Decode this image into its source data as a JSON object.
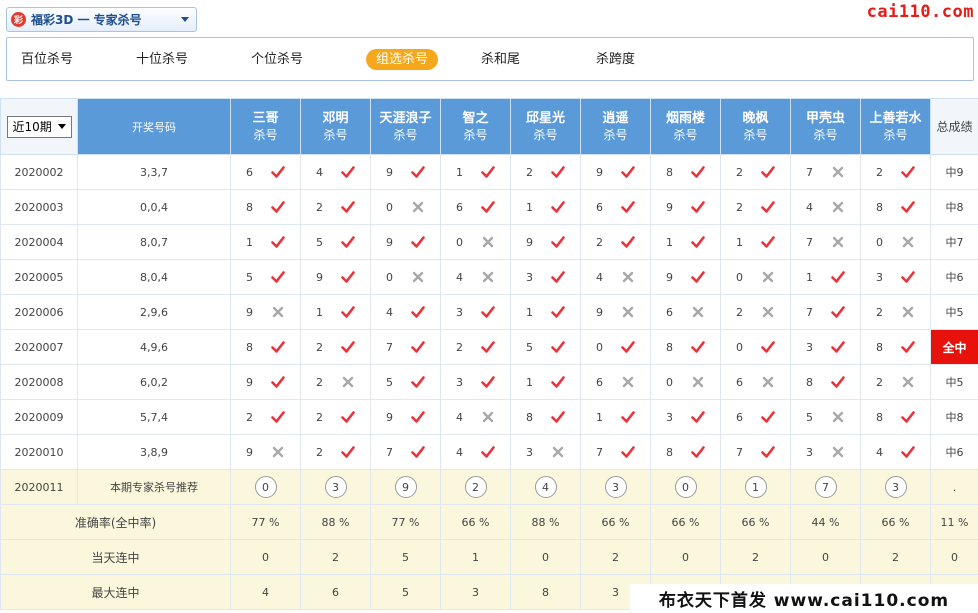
{
  "header": {
    "lottery_label": "福彩3D 一 专家杀号",
    "logo_glyph": "彩",
    "site_brand": "cai110.com"
  },
  "tabs": [
    {
      "label": "百位杀号",
      "active": false
    },
    {
      "label": "十位杀号",
      "active": false
    },
    {
      "label": "个位杀号",
      "active": false
    },
    {
      "label": "组选杀号",
      "active": true
    },
    {
      "label": "杀和尾",
      "active": false
    },
    {
      "label": "杀跨度",
      "active": false
    }
  ],
  "table": {
    "period_select": "近10期",
    "col_draw": "开奖号码",
    "col_total": "总成绩",
    "experts": [
      {
        "name": "三哥",
        "sub": "杀号"
      },
      {
        "name": "邓明",
        "sub": "杀号"
      },
      {
        "name": "天涯浪子",
        "sub": "杀号"
      },
      {
        "name": "智之",
        "sub": "杀号"
      },
      {
        "name": "邱星光",
        "sub": "杀号"
      },
      {
        "name": "逍遥",
        "sub": "杀号"
      },
      {
        "name": "烟雨楼",
        "sub": "杀号"
      },
      {
        "name": "晚枫",
        "sub": "杀号"
      },
      {
        "name": "甲壳虫",
        "sub": "杀号"
      },
      {
        "name": "上善若水",
        "sub": "杀号"
      }
    ],
    "rows": [
      {
        "issue": "2020002",
        "draw": "3,3,7",
        "kills": [
          "6",
          "4",
          "9",
          "1",
          "2",
          "9",
          "8",
          "2",
          "7",
          "2"
        ],
        "hits": [
          true,
          true,
          true,
          true,
          true,
          true,
          true,
          true,
          false,
          true
        ],
        "total": "中9"
      },
      {
        "issue": "2020003",
        "draw": "0,0,4",
        "kills": [
          "8",
          "2",
          "0",
          "6",
          "1",
          "6",
          "9",
          "2",
          "4",
          "8"
        ],
        "hits": [
          true,
          true,
          false,
          true,
          true,
          true,
          true,
          true,
          false,
          true
        ],
        "total": "中8"
      },
      {
        "issue": "2020004",
        "draw": "8,0,7",
        "kills": [
          "1",
          "5",
          "9",
          "0",
          "9",
          "2",
          "1",
          "1",
          "7",
          "0"
        ],
        "hits": [
          true,
          true,
          true,
          false,
          true,
          true,
          true,
          true,
          false,
          false
        ],
        "total": "中7"
      },
      {
        "issue": "2020005",
        "draw": "8,0,4",
        "kills": [
          "5",
          "9",
          "0",
          "4",
          "3",
          "4",
          "9",
          "0",
          "1",
          "3"
        ],
        "hits": [
          true,
          true,
          false,
          false,
          true,
          false,
          true,
          false,
          true,
          true
        ],
        "total": "中6"
      },
      {
        "issue": "2020006",
        "draw": "2,9,6",
        "kills": [
          "9",
          "1",
          "4",
          "3",
          "1",
          "9",
          "6",
          "2",
          "7",
          "2"
        ],
        "hits": [
          false,
          true,
          true,
          true,
          true,
          false,
          false,
          false,
          true,
          false
        ],
        "total": "中5"
      },
      {
        "issue": "2020007",
        "draw": "4,9,6",
        "kills": [
          "8",
          "2",
          "7",
          "2",
          "5",
          "0",
          "8",
          "0",
          "3",
          "8"
        ],
        "hits": [
          true,
          true,
          true,
          true,
          true,
          true,
          true,
          true,
          true,
          true
        ],
        "total": "全中"
      },
      {
        "issue": "2020008",
        "draw": "6,0,2",
        "kills": [
          "9",
          "2",
          "5",
          "3",
          "1",
          "6",
          "0",
          "6",
          "8",
          "2"
        ],
        "hits": [
          true,
          false,
          true,
          true,
          true,
          false,
          false,
          false,
          true,
          false
        ],
        "total": "中5"
      },
      {
        "issue": "2020009",
        "draw": "5,7,4",
        "kills": [
          "2",
          "2",
          "9",
          "4",
          "8",
          "1",
          "3",
          "6",
          "5",
          "8"
        ],
        "hits": [
          true,
          true,
          true,
          false,
          true,
          true,
          true,
          true,
          false,
          true
        ],
        "total": "中8"
      },
      {
        "issue": "2020010",
        "draw": "3,8,9",
        "kills": [
          "9",
          "2",
          "7",
          "4",
          "3",
          "7",
          "8",
          "7",
          "3",
          "4"
        ],
        "hits": [
          false,
          true,
          true,
          true,
          false,
          true,
          true,
          true,
          false,
          true
        ],
        "total": "中6"
      }
    ],
    "recommend": {
      "issue": "2020011",
      "label": "本期专家杀号推荐",
      "numbers": [
        "0",
        "3",
        "9",
        "2",
        "4",
        "3",
        "0",
        "1",
        "7",
        "3"
      ],
      "total": "."
    },
    "stats": [
      {
        "label": "准确率(全中率)",
        "values": [
          "77 %",
          "88 %",
          "77 %",
          "66 %",
          "88 %",
          "66 %",
          "66 %",
          "66 %",
          "44 %",
          "66 %"
        ],
        "total": "11 %"
      },
      {
        "label": "当天连中",
        "values": [
          "0",
          "2",
          "5",
          "1",
          "0",
          "2",
          "0",
          "2",
          "0",
          "2"
        ],
        "total": "0"
      },
      {
        "label": "最大连中",
        "values": [
          "4",
          "6",
          "5",
          "3",
          "8",
          "3",
          "",
          "",
          "",
          ""
        ],
        "total": ""
      }
    ]
  },
  "watermark": "布衣天下首发 www.cai110.com",
  "colors": {
    "header_blue": "#5a9ad9",
    "hit_red": "#e8333b",
    "miss_gray": "#a8a8a8",
    "active_tab": "#f6a81c",
    "full_hit": "#e8120c",
    "highlight_bg": "#fbf7dd"
  }
}
